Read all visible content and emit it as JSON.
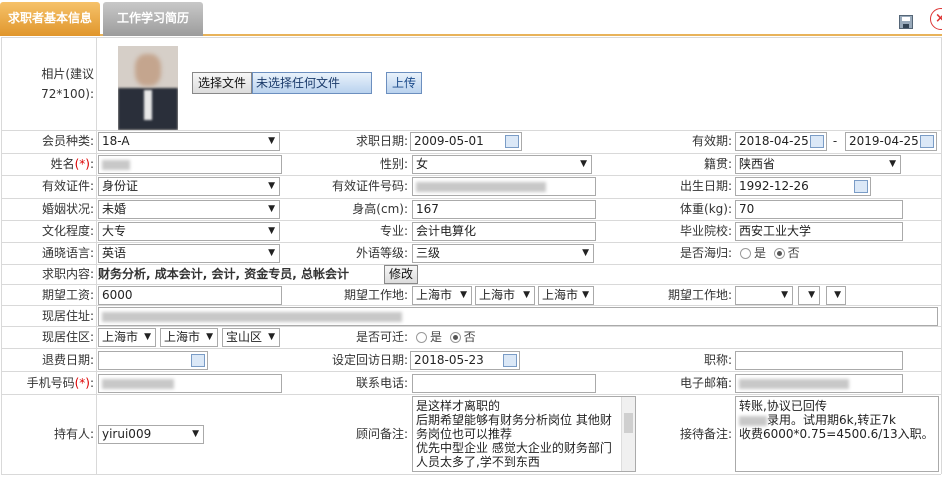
{
  "tabs": [
    {
      "label": "求职者基本信息"
    },
    {
      "label": "工作学习简历"
    }
  ],
  "photo": {
    "label": "相片(建议72*100):",
    "file_button": "选择文件",
    "file_status": "未选择任何文件",
    "upload_button": "上传"
  },
  "row1": {
    "member_type_label": "会员种类:",
    "member_type_value": "18-A",
    "apply_date_label": "求职日期:",
    "apply_date_value": "2009-05-01",
    "valid_label": "有效期:",
    "valid_from": "2018-04-25",
    "valid_sep": "-",
    "valid_to": "2019-04-25"
  },
  "row2": {
    "name_label": "姓名",
    "name_req": "(*)",
    "name_colon": ":",
    "gender_label": "性别:",
    "gender_value": "女",
    "native_label": "籍贯:",
    "native_value": "陕西省"
  },
  "row3": {
    "id_type_label": "有效证件:",
    "id_type_value": "身份证",
    "id_no_label": "有效证件号码:",
    "birth_label": "出生日期:",
    "birth_value": "1992-12-26"
  },
  "row4": {
    "marital_label": "婚姻状况:",
    "marital_value": "未婚",
    "height_label": "身高(cm):",
    "height_value": "167",
    "weight_label": "体重(kg):",
    "weight_value": "70"
  },
  "row5": {
    "edu_label": "文化程度:",
    "edu_value": "大专",
    "major_label": "专业:",
    "major_value": "会计电算化",
    "school_label": "毕业院校:",
    "school_value": "西安工业大学"
  },
  "row6": {
    "lang_label": "通晓语言:",
    "lang_value": "英语",
    "lang_level_label": "外语等级:",
    "lang_level_value": "三级",
    "overseas_label": "是否海归:",
    "yes": "是",
    "no": "否"
  },
  "row7": {
    "content_label": "求职内容:",
    "content_value": "财务分析, 成本会计, 会计, 资金专员, 总帐会计",
    "edit_button": "修改"
  },
  "row8": {
    "salary_label": "期望工资:",
    "salary_value": "6000",
    "loc_label": "期望工作地:",
    "loc1": "上海市",
    "loc2": "上海市",
    "loc3": "上海市",
    "loc2_label": "期望工作地:"
  },
  "row9": {
    "address_label": "现居住址:"
  },
  "row10": {
    "district_label": "现居住区:",
    "d1": "上海市",
    "d2": "上海市",
    "d3": "宝山区",
    "relocate_label": "是否可迁:",
    "yes": "是",
    "no": "否"
  },
  "row11": {
    "refund_label": "退费日期:",
    "revisit_label": "设定回访日期:",
    "revisit_value": "2018-05-23",
    "title_label": "职称:"
  },
  "row12": {
    "mobile_label": "手机号码",
    "mobile_req": "(*)",
    "mobile_colon": ":",
    "phone_label": "联系电话:",
    "email_label": "电子邮箱:"
  },
  "row13": {
    "holder_label": "持有人:",
    "holder_value": "yirui009",
    "consultant_label": "顾问备注:",
    "consultant_lines": [
      "是这样才离职的",
      "后期希望能够有财务分析岗位 其他财",
      "务岗位也可以推荐",
      "优先中型企业 感觉大企业的财务部门",
      "人员太多了,学不到东西"
    ],
    "reception_label": "接待备注:",
    "reception_lines": [
      "转账,协议已回传",
      "录用。试用期6k,转正7k",
      "收费6000*0.75=4500.6/13入职。"
    ]
  }
}
